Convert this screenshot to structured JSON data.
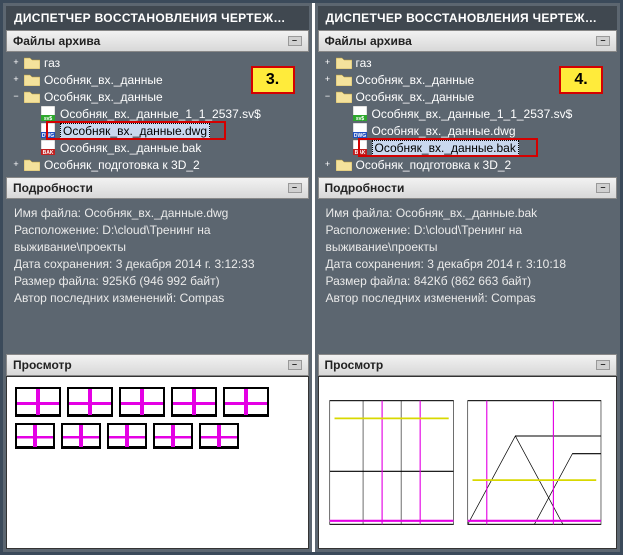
{
  "panels": [
    {
      "title": "ДИСПЕТЧЕР ВОССТАНОВЛЕНИЯ ЧЕРТЕЖ…",
      "badge": "3.",
      "sections": {
        "archive": "Файлы архива",
        "details": "Подробности",
        "preview": "Просмотр"
      },
      "tree": {
        "items": [
          {
            "label": "газ",
            "type": "folder",
            "level": 0,
            "twisty": "+"
          },
          {
            "label": "Особняк_вх._данные",
            "type": "folder",
            "level": 0,
            "twisty": "+"
          },
          {
            "label": "Особняк_вх._данные",
            "type": "folder",
            "level": 0,
            "twisty": "−"
          },
          {
            "label": "Особняк_вх._данные_1_1_2537.sv$",
            "type": "sv",
            "level": 1
          },
          {
            "label": "Особняк_вх._данные.dwg",
            "type": "dwg",
            "level": 1,
            "selected": true,
            "highlighted": true
          },
          {
            "label": "Особняк_вх._данные.bak",
            "type": "bak",
            "level": 1
          },
          {
            "label": "Особняк_подготовка к 3D_2",
            "type": "folder",
            "level": 0,
            "twisty": "+"
          }
        ]
      },
      "details": {
        "name_label": "Имя файла:",
        "name": "Особняк_вх._данные.dwg",
        "path_label": "Расположение:",
        "path": "D:\\cloud\\Тренинг на выживание\\проекты",
        "date_label": "Дата сохранения:",
        "date": "3 декабря 2014 г.  3:12:33",
        "size_label": "Размер файла:",
        "size": "925Кб (946 992 байт)",
        "author_label": "Автор последних изменений:",
        "author": "Compas"
      },
      "preview_type": "thumbs"
    },
    {
      "title": "ДИСПЕТЧЕР ВОССТАНОВЛЕНИЯ ЧЕРТЕЖ…",
      "badge": "4.",
      "sections": {
        "archive": "Файлы архива",
        "details": "Подробности",
        "preview": "Просмотр"
      },
      "tree": {
        "items": [
          {
            "label": "газ",
            "type": "folder",
            "level": 0,
            "twisty": "+"
          },
          {
            "label": "Особняк_вх._данные",
            "type": "folder",
            "level": 0,
            "twisty": "+"
          },
          {
            "label": "Особняк_вх._данные",
            "type": "folder",
            "level": 0,
            "twisty": "−"
          },
          {
            "label": "Особняк_вх._данные_1_1_2537.sv$",
            "type": "sv",
            "level": 1
          },
          {
            "label": "Особняк_вх._данные.dwg",
            "type": "dwg",
            "level": 1
          },
          {
            "label": "Особняк_вх._данные.bak",
            "type": "bak",
            "level": 1,
            "selected": true,
            "highlighted": true
          },
          {
            "label": "Особняк_подготовка к 3D_2",
            "type": "folder",
            "level": 0,
            "twisty": "+"
          }
        ]
      },
      "details": {
        "name_label": "Имя файла:",
        "name": "Особняк_вх._данные.bak",
        "path_label": "Расположение:",
        "path": "D:\\cloud\\Тренинг на выживание\\проекты",
        "date_label": "Дата сохранения:",
        "date": "3 декабря 2014 г.  3:10:18",
        "size_label": "Размер файла:",
        "size": "842Кб (862 663 байт)",
        "author_label": "Автор последних изменений:",
        "author": "Compas"
      },
      "preview_type": "floorplan"
    }
  ],
  "collapse_glyph": "–"
}
